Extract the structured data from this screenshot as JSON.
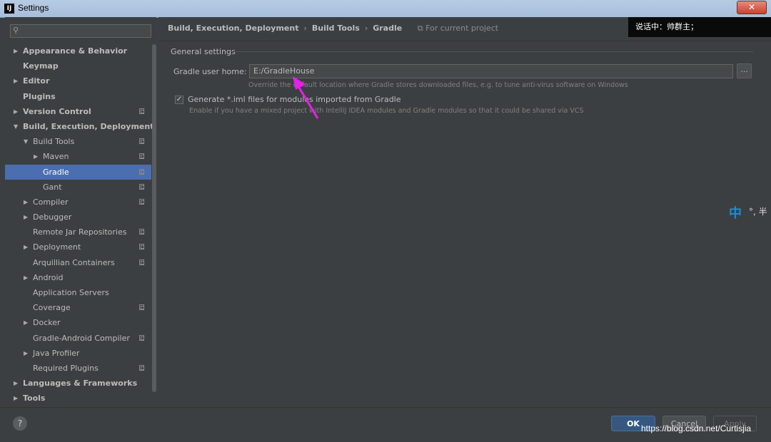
{
  "window": {
    "title": "Settings",
    "app_icon": "IJ",
    "close_glyph": "✕"
  },
  "search": {
    "placeholder": "",
    "icon": "search-icon"
  },
  "sidebar": {
    "items": [
      {
        "label": "Appearance & Behavior",
        "level": 0,
        "arrow": "▶",
        "bold": true,
        "proj": false
      },
      {
        "label": "Keymap",
        "level": 0,
        "arrow": "",
        "bold": true,
        "proj": false
      },
      {
        "label": "Editor",
        "level": 0,
        "arrow": "▶",
        "bold": true,
        "proj": false
      },
      {
        "label": "Plugins",
        "level": 0,
        "arrow": "",
        "bold": true,
        "proj": false
      },
      {
        "label": "Version Control",
        "level": 0,
        "arrow": "▶",
        "bold": true,
        "proj": true
      },
      {
        "label": "Build, Execution, Deployment",
        "level": 0,
        "arrow": "▼",
        "bold": true,
        "proj": false
      },
      {
        "label": "Build Tools",
        "level": 1,
        "arrow": "▼",
        "bold": false,
        "proj": true
      },
      {
        "label": "Maven",
        "level": 2,
        "arrow": "▶",
        "bold": false,
        "proj": true
      },
      {
        "label": "Gradle",
        "level": 2,
        "arrow": "",
        "bold": false,
        "proj": true,
        "selected": true
      },
      {
        "label": "Gant",
        "level": 2,
        "arrow": "",
        "bold": false,
        "proj": true
      },
      {
        "label": "Compiler",
        "level": 1,
        "arrow": "▶",
        "bold": false,
        "proj": true
      },
      {
        "label": "Debugger",
        "level": 1,
        "arrow": "▶",
        "bold": false,
        "proj": false
      },
      {
        "label": "Remote Jar Repositories",
        "level": 1,
        "arrow": "",
        "bold": false,
        "proj": true
      },
      {
        "label": "Deployment",
        "level": 1,
        "arrow": "▶",
        "bold": false,
        "proj": true
      },
      {
        "label": "Arquillian Containers",
        "level": 1,
        "arrow": "",
        "bold": false,
        "proj": true
      },
      {
        "label": "Android",
        "level": 1,
        "arrow": "▶",
        "bold": false,
        "proj": false
      },
      {
        "label": "Application Servers",
        "level": 1,
        "arrow": "",
        "bold": false,
        "proj": false
      },
      {
        "label": "Coverage",
        "level": 1,
        "arrow": "",
        "bold": false,
        "proj": true
      },
      {
        "label": "Docker",
        "level": 1,
        "arrow": "▶",
        "bold": false,
        "proj": false
      },
      {
        "label": "Gradle-Android Compiler",
        "level": 1,
        "arrow": "",
        "bold": false,
        "proj": true
      },
      {
        "label": "Java Profiler",
        "level": 1,
        "arrow": "▶",
        "bold": false,
        "proj": false
      },
      {
        "label": "Required Plugins",
        "level": 1,
        "arrow": "",
        "bold": false,
        "proj": true
      },
      {
        "label": "Languages & Frameworks",
        "level": 0,
        "arrow": "▶",
        "bold": true,
        "proj": false
      },
      {
        "label": "Tools",
        "level": 0,
        "arrow": "▶",
        "bold": true,
        "proj": false
      }
    ]
  },
  "breadcrumb": {
    "parts": [
      "Build, Execution, Deployment",
      "Build Tools",
      "Gradle"
    ],
    "separator": "›",
    "scope": "For current project"
  },
  "settings": {
    "section": "General settings",
    "gradle_home_label": "Gradle user home:",
    "gradle_home_value": "E:/GradleHouse",
    "browse_label": "...",
    "gradle_home_hint": "Override the default location where Gradle stores downloaded files, e.g. to tune anti-virus software on Windows",
    "generate_iml_label": "Generate *.iml files for modules imported from Gradle",
    "generate_iml_checked": "✓",
    "generate_iml_hint": "Enable if you have a mixed project with IntelliJ IDEA modules and Gradle modules so that it could be shared via VCS"
  },
  "footer": {
    "help": "?",
    "ok": "OK",
    "cancel": "Cancel",
    "apply": "Apply"
  },
  "overlay": {
    "text": "说话中：帅群主；"
  },
  "ime": {
    "zh": "中",
    "rest": "°, 半"
  },
  "watermark": "https://blog.csdn.net/Curtisjia",
  "colors": {
    "selection": "#4b6eaf",
    "ok_button": "#365880",
    "annotation_arrow": "#e620e6"
  }
}
